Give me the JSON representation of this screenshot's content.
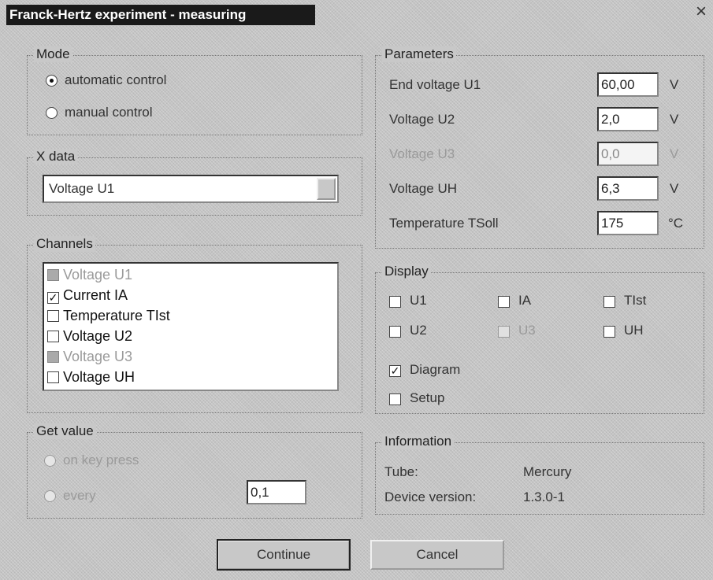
{
  "window": {
    "title": "Franck-Hertz experiment - measuring"
  },
  "mode": {
    "title": "Mode",
    "options": [
      {
        "label": "automatic control",
        "selected": true
      },
      {
        "label": "manual control",
        "selected": false
      }
    ]
  },
  "xdata": {
    "title": "X data",
    "selected": "Voltage U1"
  },
  "channels": {
    "title": "Channels",
    "items": [
      {
        "label": "Voltage U1",
        "state": "grey",
        "enabled": false
      },
      {
        "label": "Current IA",
        "state": "checked",
        "enabled": true
      },
      {
        "label": "Temperature TIst",
        "state": "unchecked",
        "enabled": true
      },
      {
        "label": "Voltage U2",
        "state": "unchecked",
        "enabled": true
      },
      {
        "label": "Voltage U3",
        "state": "grey",
        "enabled": false
      },
      {
        "label": "Voltage UH",
        "state": "unchecked",
        "enabled": true
      }
    ]
  },
  "getvalue": {
    "title": "Get value",
    "options": [
      {
        "label": "on key press",
        "selected": false
      },
      {
        "label": "every",
        "selected": false
      }
    ],
    "every_value": "0,1"
  },
  "parameters": {
    "title": "Parameters",
    "rows": [
      {
        "label": "End voltage U1",
        "value": "60,00",
        "unit": "V",
        "enabled": true
      },
      {
        "label": "Voltage U2",
        "value": "2,0",
        "unit": "V",
        "enabled": true
      },
      {
        "label": "Voltage U3",
        "value": "0,0",
        "unit": "V",
        "enabled": false
      },
      {
        "label": "Voltage UH",
        "value": "6,3",
        "unit": "V",
        "enabled": true
      },
      {
        "label": "Temperature TSoll",
        "value": "175",
        "unit": "°C",
        "enabled": true
      }
    ]
  },
  "display": {
    "title": "Display",
    "checks": [
      {
        "label": "U1",
        "checked": false,
        "enabled": true
      },
      {
        "label": "IA",
        "checked": false,
        "enabled": true
      },
      {
        "label": "TIst",
        "checked": false,
        "enabled": true
      },
      {
        "label": "U2",
        "checked": false,
        "enabled": true
      },
      {
        "label": "U3",
        "checked": false,
        "enabled": false
      },
      {
        "label": "UH",
        "checked": false,
        "enabled": true
      }
    ],
    "diagram": {
      "label": "Diagram",
      "checked": true
    },
    "setup": {
      "label": "Setup",
      "checked": false
    }
  },
  "information": {
    "title": "Information",
    "tube_label": "Tube:",
    "tube_value": "Mercury",
    "device_label": "Device version:",
    "device_value": "1.3.0-1"
  },
  "buttons": {
    "continue": "Continue",
    "cancel": "Cancel"
  }
}
